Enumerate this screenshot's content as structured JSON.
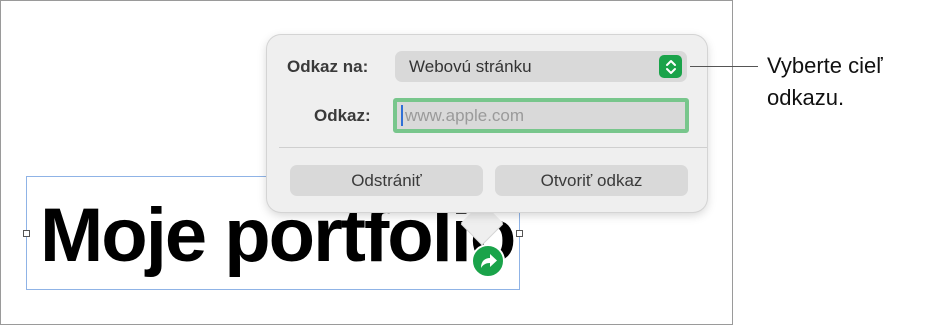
{
  "document": {
    "title_text": "Moje portfolio"
  },
  "link_popover": {
    "link_to_label": "Odkaz na:",
    "link_to_value": "Webovú stránku",
    "link_field_label": "Odkaz:",
    "link_field_value": "",
    "link_field_placeholder": "www.apple.com",
    "remove_button_label": "Odstrániť",
    "open_button_label": "Otvoriť odkaz"
  },
  "callout": {
    "line1": "Vyberte cieľ",
    "line2": "odkazu."
  },
  "icons": {
    "stepper": "up-down-chevron-icon",
    "link_badge": "curved-arrow-icon"
  },
  "colors": {
    "accent_green": "#1aa34a",
    "focus_ring": "#78c68c",
    "selection_border": "#8fb3e6"
  }
}
